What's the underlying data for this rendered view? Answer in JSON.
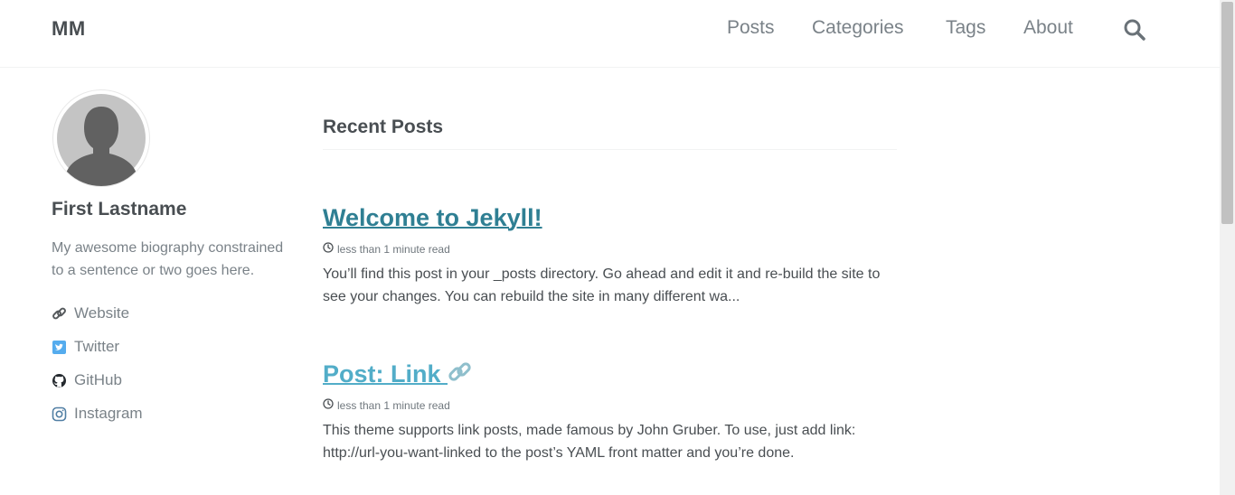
{
  "site": {
    "title": "MM"
  },
  "nav": {
    "items": [
      {
        "label": "Posts"
      },
      {
        "label": "Categories"
      },
      {
        "label": "Tags"
      },
      {
        "label": "About"
      }
    ],
    "search_icon": "search-icon"
  },
  "author": {
    "name": "First Lastname",
    "bio": "My awesome biography constrained to a sentence or two goes here.",
    "links": [
      {
        "label": "Website",
        "icon": "link-icon"
      },
      {
        "label": "Twitter",
        "icon": "twitter-icon"
      },
      {
        "label": "GitHub",
        "icon": "github-icon"
      },
      {
        "label": "Instagram",
        "icon": "instagram-icon"
      }
    ]
  },
  "main": {
    "section_title": "Recent Posts",
    "posts": [
      {
        "title": "Welcome to Jekyll!",
        "read_time": "less than 1 minute read",
        "excerpt": "You’ll find this post in your _posts directory. Go ahead and edit it and re-build the site to see your changes. You can rebuild the site in many different wa..."
      },
      {
        "title": "Post: Link",
        "read_time": "less than 1 minute read",
        "excerpt": "This theme supports link posts, made famous by John Gruber. To use, just add link: http://url-you-want-linked to the post’s YAML front matter and you’re done."
      }
    ]
  },
  "colors": {
    "accent": "#2f7f93",
    "accent_light": "#52adc8",
    "text": "#494e52",
    "muted": "#7a8288",
    "twitter": "#55acee"
  }
}
